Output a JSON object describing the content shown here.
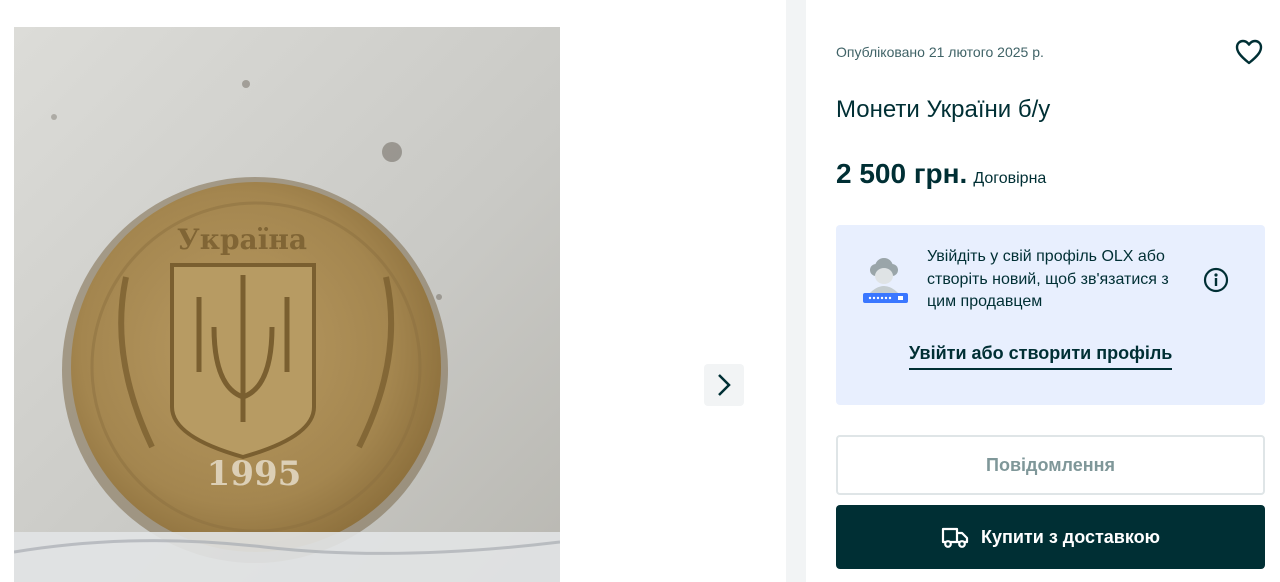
{
  "listing": {
    "published": "Опубліковано 21 лютого 2025 р.",
    "title": "Монети України б/у",
    "price": "2 500 грн.",
    "negotiable": "Договірна"
  },
  "photo": {
    "coin_inscription": "Україна",
    "coin_year": "1995"
  },
  "login_box": {
    "text": "Увійдіть у свій профіль OLX або створіть новий, щоб зв'язатися з цим продавцем",
    "link": "Увійти або створити профіль"
  },
  "actions": {
    "message": "Повідомлення",
    "buy": "Купити з доставкою"
  },
  "icons": {
    "favorite": "heart-icon",
    "next": "chevron-right-icon",
    "info": "info-icon",
    "delivery": "truck-icon",
    "avatar": "avatar-placeholder-icon"
  },
  "colors": {
    "primary": "#002f34",
    "login_box_bg": "#e8effe",
    "disabled_text": "#7f9799"
  }
}
